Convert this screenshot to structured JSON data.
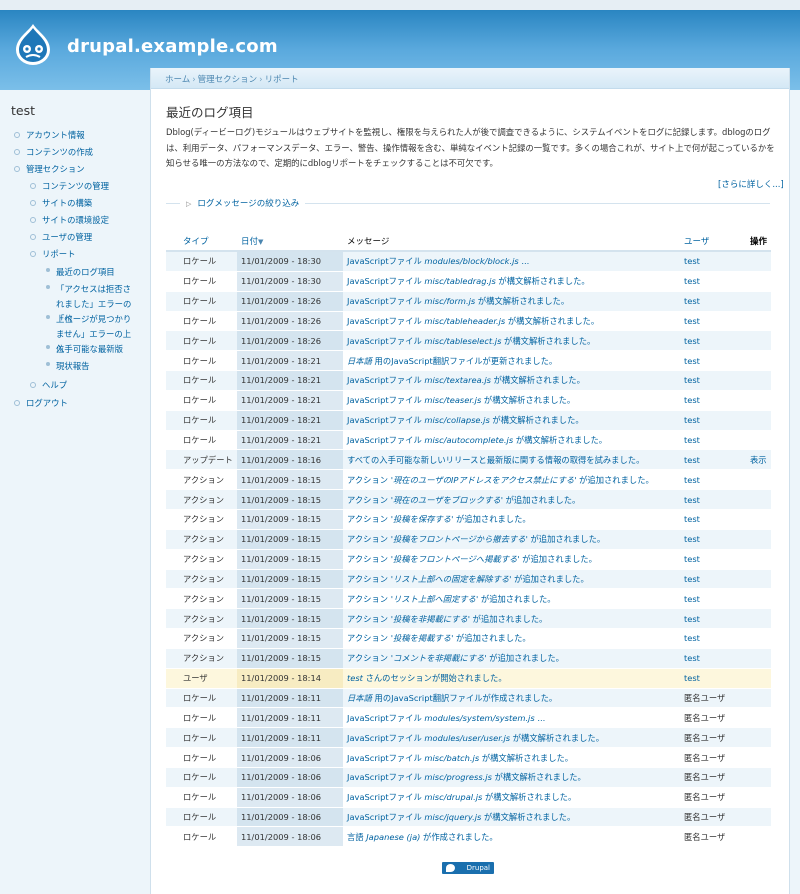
{
  "site": {
    "name": "drupal.example.com"
  },
  "breadcrumb": {
    "items": [
      "ホーム",
      "管理セクション",
      "リポート"
    ],
    "separator": "›"
  },
  "page": {
    "title": "最近のログ項目",
    "help": "Dblog(ディービーログ)モジュールはウェブサイトを監視し、権限を与えられた人が後で調査できるように、システムイベントをログに記録します。dblogのログは、利用データ、パフォーマンスデータ、エラー、警告、操作情報を含む、単純なイベント記録の一覧です。多くの場合これが、サイト上で何が起こっているかを知らせる唯一の方法なので、定期的にdblogリポートをチェックすることは不可欠です。",
    "more_link": "[さらに詳しく...]",
    "filter_legend": "ログメッセージの絞り込み"
  },
  "sidebar": {
    "title": "test",
    "items": [
      {
        "label": "アカウント情報",
        "level": 0
      },
      {
        "label": "コンテンツの作成",
        "level": 0
      },
      {
        "label": "管理セクション",
        "level": 0
      },
      {
        "label": "コンテンツの管理",
        "level": 1
      },
      {
        "label": "サイトの構築",
        "level": 1
      },
      {
        "label": "サイトの環境設定",
        "level": 1
      },
      {
        "label": "ユーザの管理",
        "level": 1
      },
      {
        "label": "リポート",
        "level": 1
      },
      {
        "label": "最近のログ項目",
        "level": 2
      },
      {
        "label": "「アクセスは拒否されました」エラーの上位",
        "level": 2
      },
      {
        "label": "「ページが見つかりません」エラーの上位",
        "level": 2
      },
      {
        "label": "入手可能な最新版",
        "level": 2
      },
      {
        "label": "現状報告",
        "level": 2
      },
      {
        "label": "ヘルプ",
        "level": 1
      },
      {
        "label": "ログアウト",
        "level": 0
      }
    ]
  },
  "table": {
    "headers": {
      "type": "タイプ",
      "date": "日付",
      "message": "メッセージ",
      "user": "ユーザ",
      "operations": "操作"
    },
    "rows": [
      {
        "type": "ロケール",
        "date": "11/01/2009 - 18:30",
        "msg_pre": "JavaScriptファイル ",
        "msg_em": "modules/block/block.js",
        "msg_post": " ...",
        "user": "test",
        "op": ""
      },
      {
        "type": "ロケール",
        "date": "11/01/2009 - 18:30",
        "msg_pre": "JavaScriptファイル ",
        "msg_em": "misc/tabledrag.js",
        "msg_post": " が構文解析されました。",
        "user": "test",
        "op": ""
      },
      {
        "type": "ロケール",
        "date": "11/01/2009 - 18:26",
        "msg_pre": "JavaScriptファイル ",
        "msg_em": "misc/form.js",
        "msg_post": " が構文解析されました。",
        "user": "test",
        "op": ""
      },
      {
        "type": "ロケール",
        "date": "11/01/2009 - 18:26",
        "msg_pre": "JavaScriptファイル ",
        "msg_em": "misc/tableheader.js",
        "msg_post": " が構文解析されました。",
        "user": "test",
        "op": ""
      },
      {
        "type": "ロケール",
        "date": "11/01/2009 - 18:26",
        "msg_pre": "JavaScriptファイル ",
        "msg_em": "misc/tableselect.js",
        "msg_post": " が構文解析されました。",
        "user": "test",
        "op": ""
      },
      {
        "type": "ロケール",
        "date": "11/01/2009 - 18:21",
        "msg_pre": "",
        "msg_em": "日本語",
        "msg_post": " 用のJavaScript翻訳ファイルが更新されました。",
        "user": "test",
        "op": ""
      },
      {
        "type": "ロケール",
        "date": "11/01/2009 - 18:21",
        "msg_pre": "JavaScriptファイル ",
        "msg_em": "misc/textarea.js",
        "msg_post": " が構文解析されました。",
        "user": "test",
        "op": ""
      },
      {
        "type": "ロケール",
        "date": "11/01/2009 - 18:21",
        "msg_pre": "JavaScriptファイル ",
        "msg_em": "misc/teaser.js",
        "msg_post": " が構文解析されました。",
        "user": "test",
        "op": ""
      },
      {
        "type": "ロケール",
        "date": "11/01/2009 - 18:21",
        "msg_pre": "JavaScriptファイル ",
        "msg_em": "misc/collapse.js",
        "msg_post": " が構文解析されました。",
        "user": "test",
        "op": ""
      },
      {
        "type": "ロケール",
        "date": "11/01/2009 - 18:21",
        "msg_pre": "JavaScriptファイル ",
        "msg_em": "misc/autocomplete.js",
        "msg_post": " が構文解析されました。",
        "user": "test",
        "op": ""
      },
      {
        "type": "アップデート",
        "date": "11/01/2009 - 18:16",
        "msg_pre": "すべての入手可能な新しいリリースと最新版に関する情報の取得を試みました。",
        "msg_em": "",
        "msg_post": "",
        "user": "test",
        "op": "表示"
      },
      {
        "type": "アクション",
        "date": "11/01/2009 - 18:15",
        "msg_pre": "アクション '",
        "msg_em": "現在のユーザのIPアドレスをアクセス禁止にする",
        "msg_post": "' が追加されました。",
        "user": "test",
        "op": ""
      },
      {
        "type": "アクション",
        "date": "11/01/2009 - 18:15",
        "msg_pre": "アクション '",
        "msg_em": "現在のユーザをブロックする",
        "msg_post": "' が追加されました。",
        "user": "test",
        "op": ""
      },
      {
        "type": "アクション",
        "date": "11/01/2009 - 18:15",
        "msg_pre": "アクション '",
        "msg_em": "投稿を保存する",
        "msg_post": "' が追加されました。",
        "user": "test",
        "op": ""
      },
      {
        "type": "アクション",
        "date": "11/01/2009 - 18:15",
        "msg_pre": "アクション '",
        "msg_em": "投稿をフロントページから撤去する",
        "msg_post": "' が追加されました。",
        "user": "test",
        "op": ""
      },
      {
        "type": "アクション",
        "date": "11/01/2009 - 18:15",
        "msg_pre": "アクション '",
        "msg_em": "投稿をフロントページへ掲載する",
        "msg_post": "' が追加されました。",
        "user": "test",
        "op": ""
      },
      {
        "type": "アクション",
        "date": "11/01/2009 - 18:15",
        "msg_pre": "アクション '",
        "msg_em": "リスト上部への固定を解除する",
        "msg_post": "' が追加されました。",
        "user": "test",
        "op": ""
      },
      {
        "type": "アクション",
        "date": "11/01/2009 - 18:15",
        "msg_pre": "アクション '",
        "msg_em": "リスト上部へ固定する",
        "msg_post": "' が追加されました。",
        "user": "test",
        "op": ""
      },
      {
        "type": "アクション",
        "date": "11/01/2009 - 18:15",
        "msg_pre": "アクション '",
        "msg_em": "投稿を非掲載にする",
        "msg_post": "' が追加されました。",
        "user": "test",
        "op": ""
      },
      {
        "type": "アクション",
        "date": "11/01/2009 - 18:15",
        "msg_pre": "アクション '",
        "msg_em": "投稿を掲載する",
        "msg_post": "' が追加されました。",
        "user": "test",
        "op": ""
      },
      {
        "type": "アクション",
        "date": "11/01/2009 - 18:15",
        "msg_pre": "アクション '",
        "msg_em": "コメントを非掲載にする",
        "msg_post": "' が追加されました。",
        "user": "test",
        "op": ""
      },
      {
        "type": "ユーザ",
        "date": "11/01/2009 - 18:14",
        "msg_pre": "",
        "msg_em": "test",
        "msg_post": " さんのセッションが開始されました。",
        "user": "test",
        "op": "",
        "highlight": true
      },
      {
        "type": "ロケール",
        "date": "11/01/2009 - 18:11",
        "msg_pre": "",
        "msg_em": "日本語",
        "msg_post": " 用のJavaScript翻訳ファイルが作成されました。",
        "user": "匿名ユーザ",
        "op": ""
      },
      {
        "type": "ロケール",
        "date": "11/01/2009 - 18:11",
        "msg_pre": "JavaScriptファイル ",
        "msg_em": "modules/system/system.js",
        "msg_post": " ...",
        "user": "匿名ユーザ",
        "op": ""
      },
      {
        "type": "ロケール",
        "date": "11/01/2009 - 18:11",
        "msg_pre": "JavaScriptファイル ",
        "msg_em": "modules/user/user.js",
        "msg_post": " が構文解析されました。",
        "user": "匿名ユーザ",
        "op": ""
      },
      {
        "type": "ロケール",
        "date": "11/01/2009 - 18:06",
        "msg_pre": "JavaScriptファイル ",
        "msg_em": "misc/batch.js",
        "msg_post": " が構文解析されました。",
        "user": "匿名ユーザ",
        "op": ""
      },
      {
        "type": "ロケール",
        "date": "11/01/2009 - 18:06",
        "msg_pre": "JavaScriptファイル ",
        "msg_em": "misc/progress.js",
        "msg_post": " が構文解析されました。",
        "user": "匿名ユーザ",
        "op": ""
      },
      {
        "type": "ロケール",
        "date": "11/01/2009 - 18:06",
        "msg_pre": "JavaScriptファイル ",
        "msg_em": "misc/drupal.js",
        "msg_post": " が構文解析されました。",
        "user": "匿名ユーザ",
        "op": ""
      },
      {
        "type": "ロケール",
        "date": "11/01/2009 - 18:06",
        "msg_pre": "JavaScriptファイル ",
        "msg_em": "misc/jquery.js",
        "msg_post": " が構文解析されました。",
        "user": "匿名ユーザ",
        "op": ""
      },
      {
        "type": "ロケール",
        "date": "11/01/2009 - 18:06",
        "msg_pre": "言語 ",
        "msg_em": "Japanese (ja)",
        "msg_post": " が作成されました。",
        "user": "匿名ユーザ",
        "op": ""
      }
    ]
  },
  "footer": {
    "badge": "Drupal"
  }
}
